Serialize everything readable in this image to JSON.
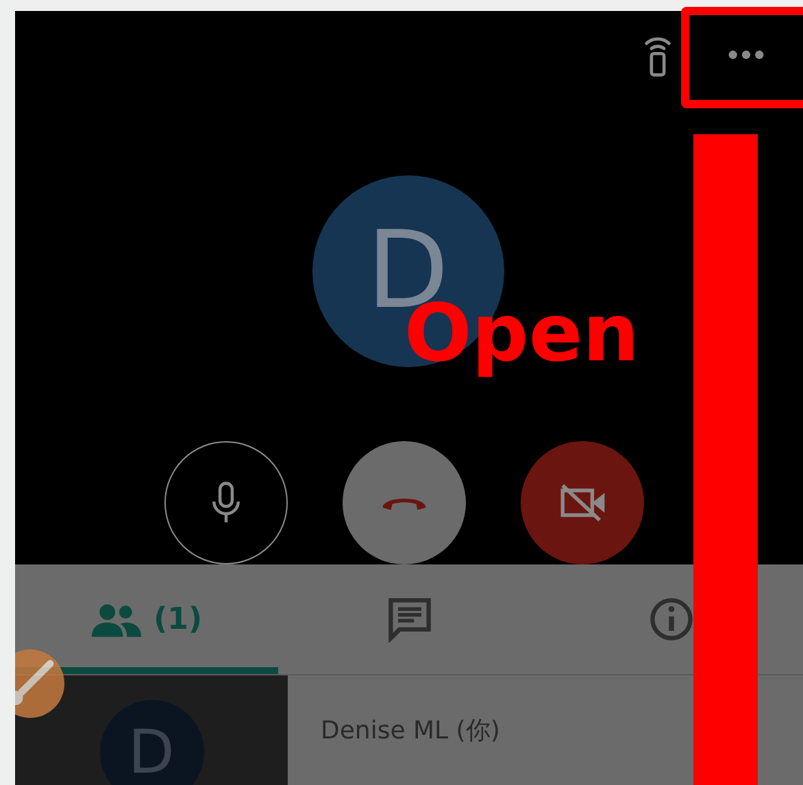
{
  "call": {
    "avatar_letter": "D",
    "mic_muted": false,
    "camera_off": true
  },
  "tabs": [
    {
      "kind": "people",
      "label": "(1)",
      "selected": true
    },
    {
      "kind": "chat",
      "selected": false
    },
    {
      "kind": "info",
      "selected": false
    }
  ],
  "participants": [
    {
      "avatar_letter": "D",
      "name": "Denise ML (你)"
    }
  ],
  "annotation": {
    "label": "Open"
  }
}
